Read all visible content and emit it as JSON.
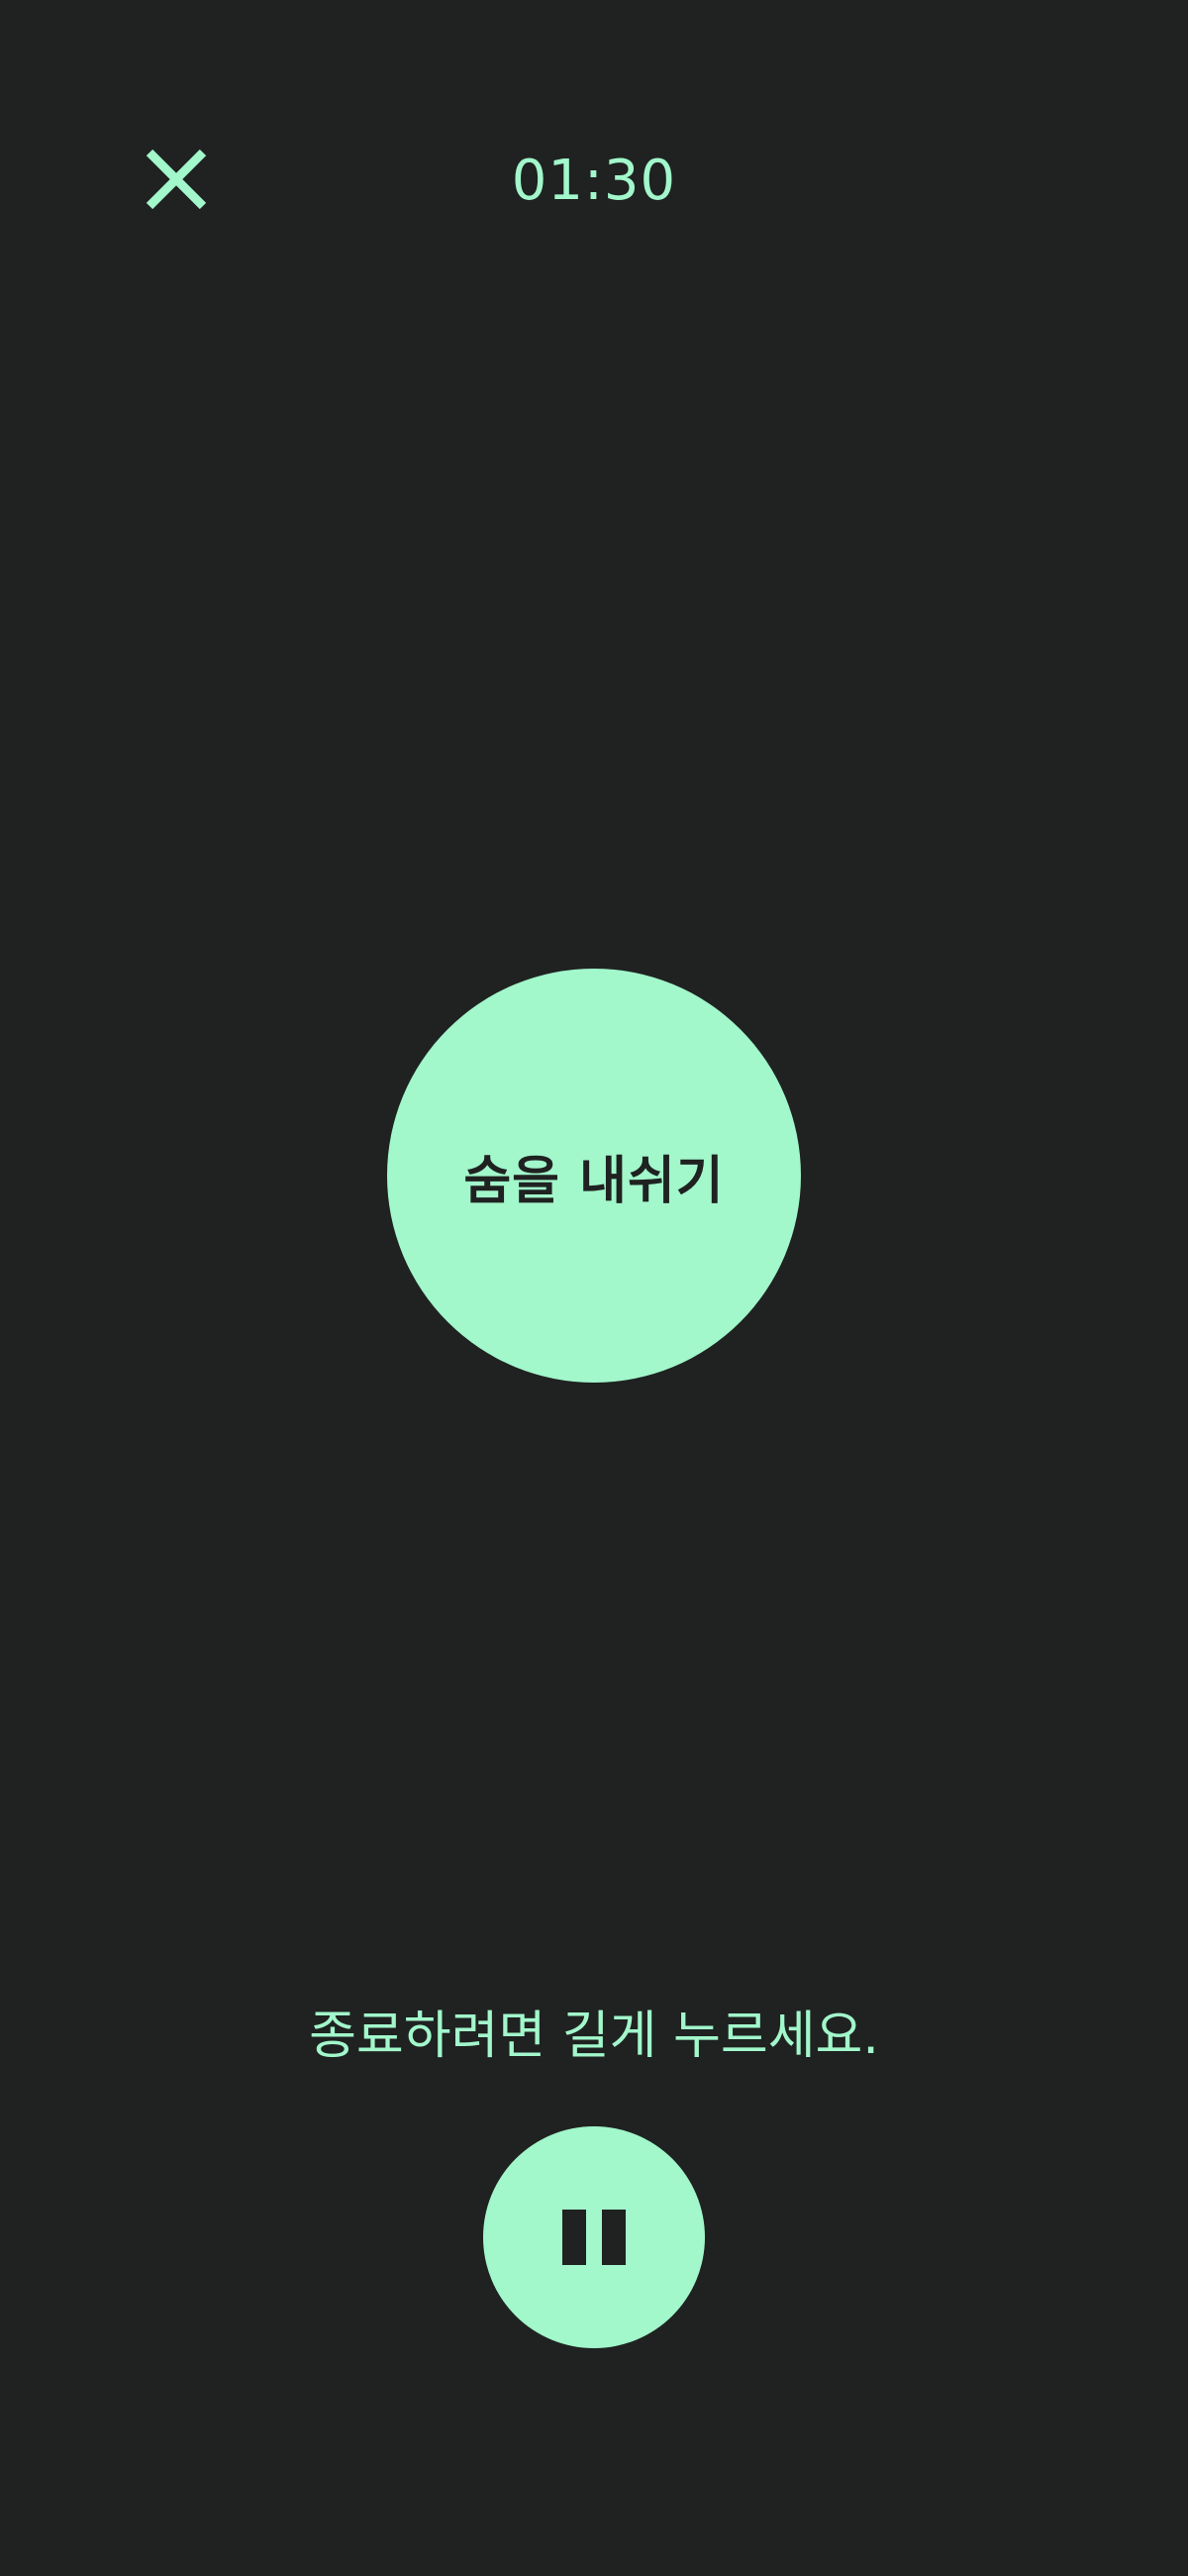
{
  "header": {
    "close_icon": "close-icon",
    "timer": "01:30"
  },
  "breath": {
    "instruction": "숨을 내쉬기"
  },
  "footer": {
    "hint": "종료하려면 길게 누르세요.",
    "pause_icon": "pause-icon"
  },
  "colors": {
    "background": "#1f2221",
    "accent": "#a2f7cb"
  }
}
